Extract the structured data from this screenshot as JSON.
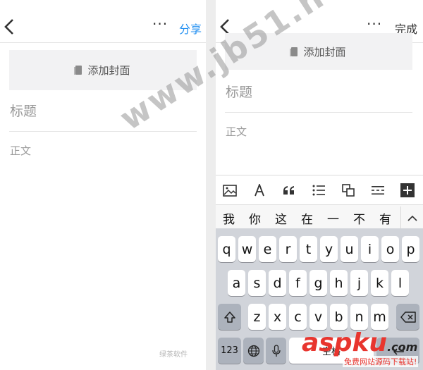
{
  "left": {
    "more": "···",
    "action": "分享",
    "cover": "添加封面",
    "title_placeholder": "标题",
    "body_placeholder": "正文"
  },
  "right": {
    "more": "···",
    "action": "完成",
    "cover": "添加封面",
    "title_placeholder": "标题",
    "body_placeholder": "正文"
  },
  "toolbar": {
    "icons": [
      "image-icon",
      "font-icon",
      "quote-icon",
      "bullet-list-icon",
      "copy-icon",
      "divider-icon",
      "add-icon"
    ]
  },
  "candidates": [
    "我",
    "你",
    "这",
    "在",
    "一",
    "不",
    "有"
  ],
  "keyboard": {
    "row1": [
      "q",
      "w",
      "e",
      "r",
      "t",
      "y",
      "u",
      "i",
      "o",
      "p"
    ],
    "row2": [
      "a",
      "s",
      "d",
      "f",
      "g",
      "h",
      "j",
      "k",
      "l"
    ],
    "row3": [
      "z",
      "x",
      "c",
      "v",
      "b",
      "n",
      "m"
    ],
    "numbers": "123",
    "space": "空格"
  },
  "watermarks": {
    "site": "www.jb51.net",
    "brand": "aspku",
    "brand_com": ".com",
    "brand_sub": "免费网站源码下载站!",
    "corner": "绿茶软件"
  },
  "colors": {
    "accent": "#1f8ef1",
    "keyboard_bg": "#d1d4da",
    "brand_red": "#e8352e"
  }
}
